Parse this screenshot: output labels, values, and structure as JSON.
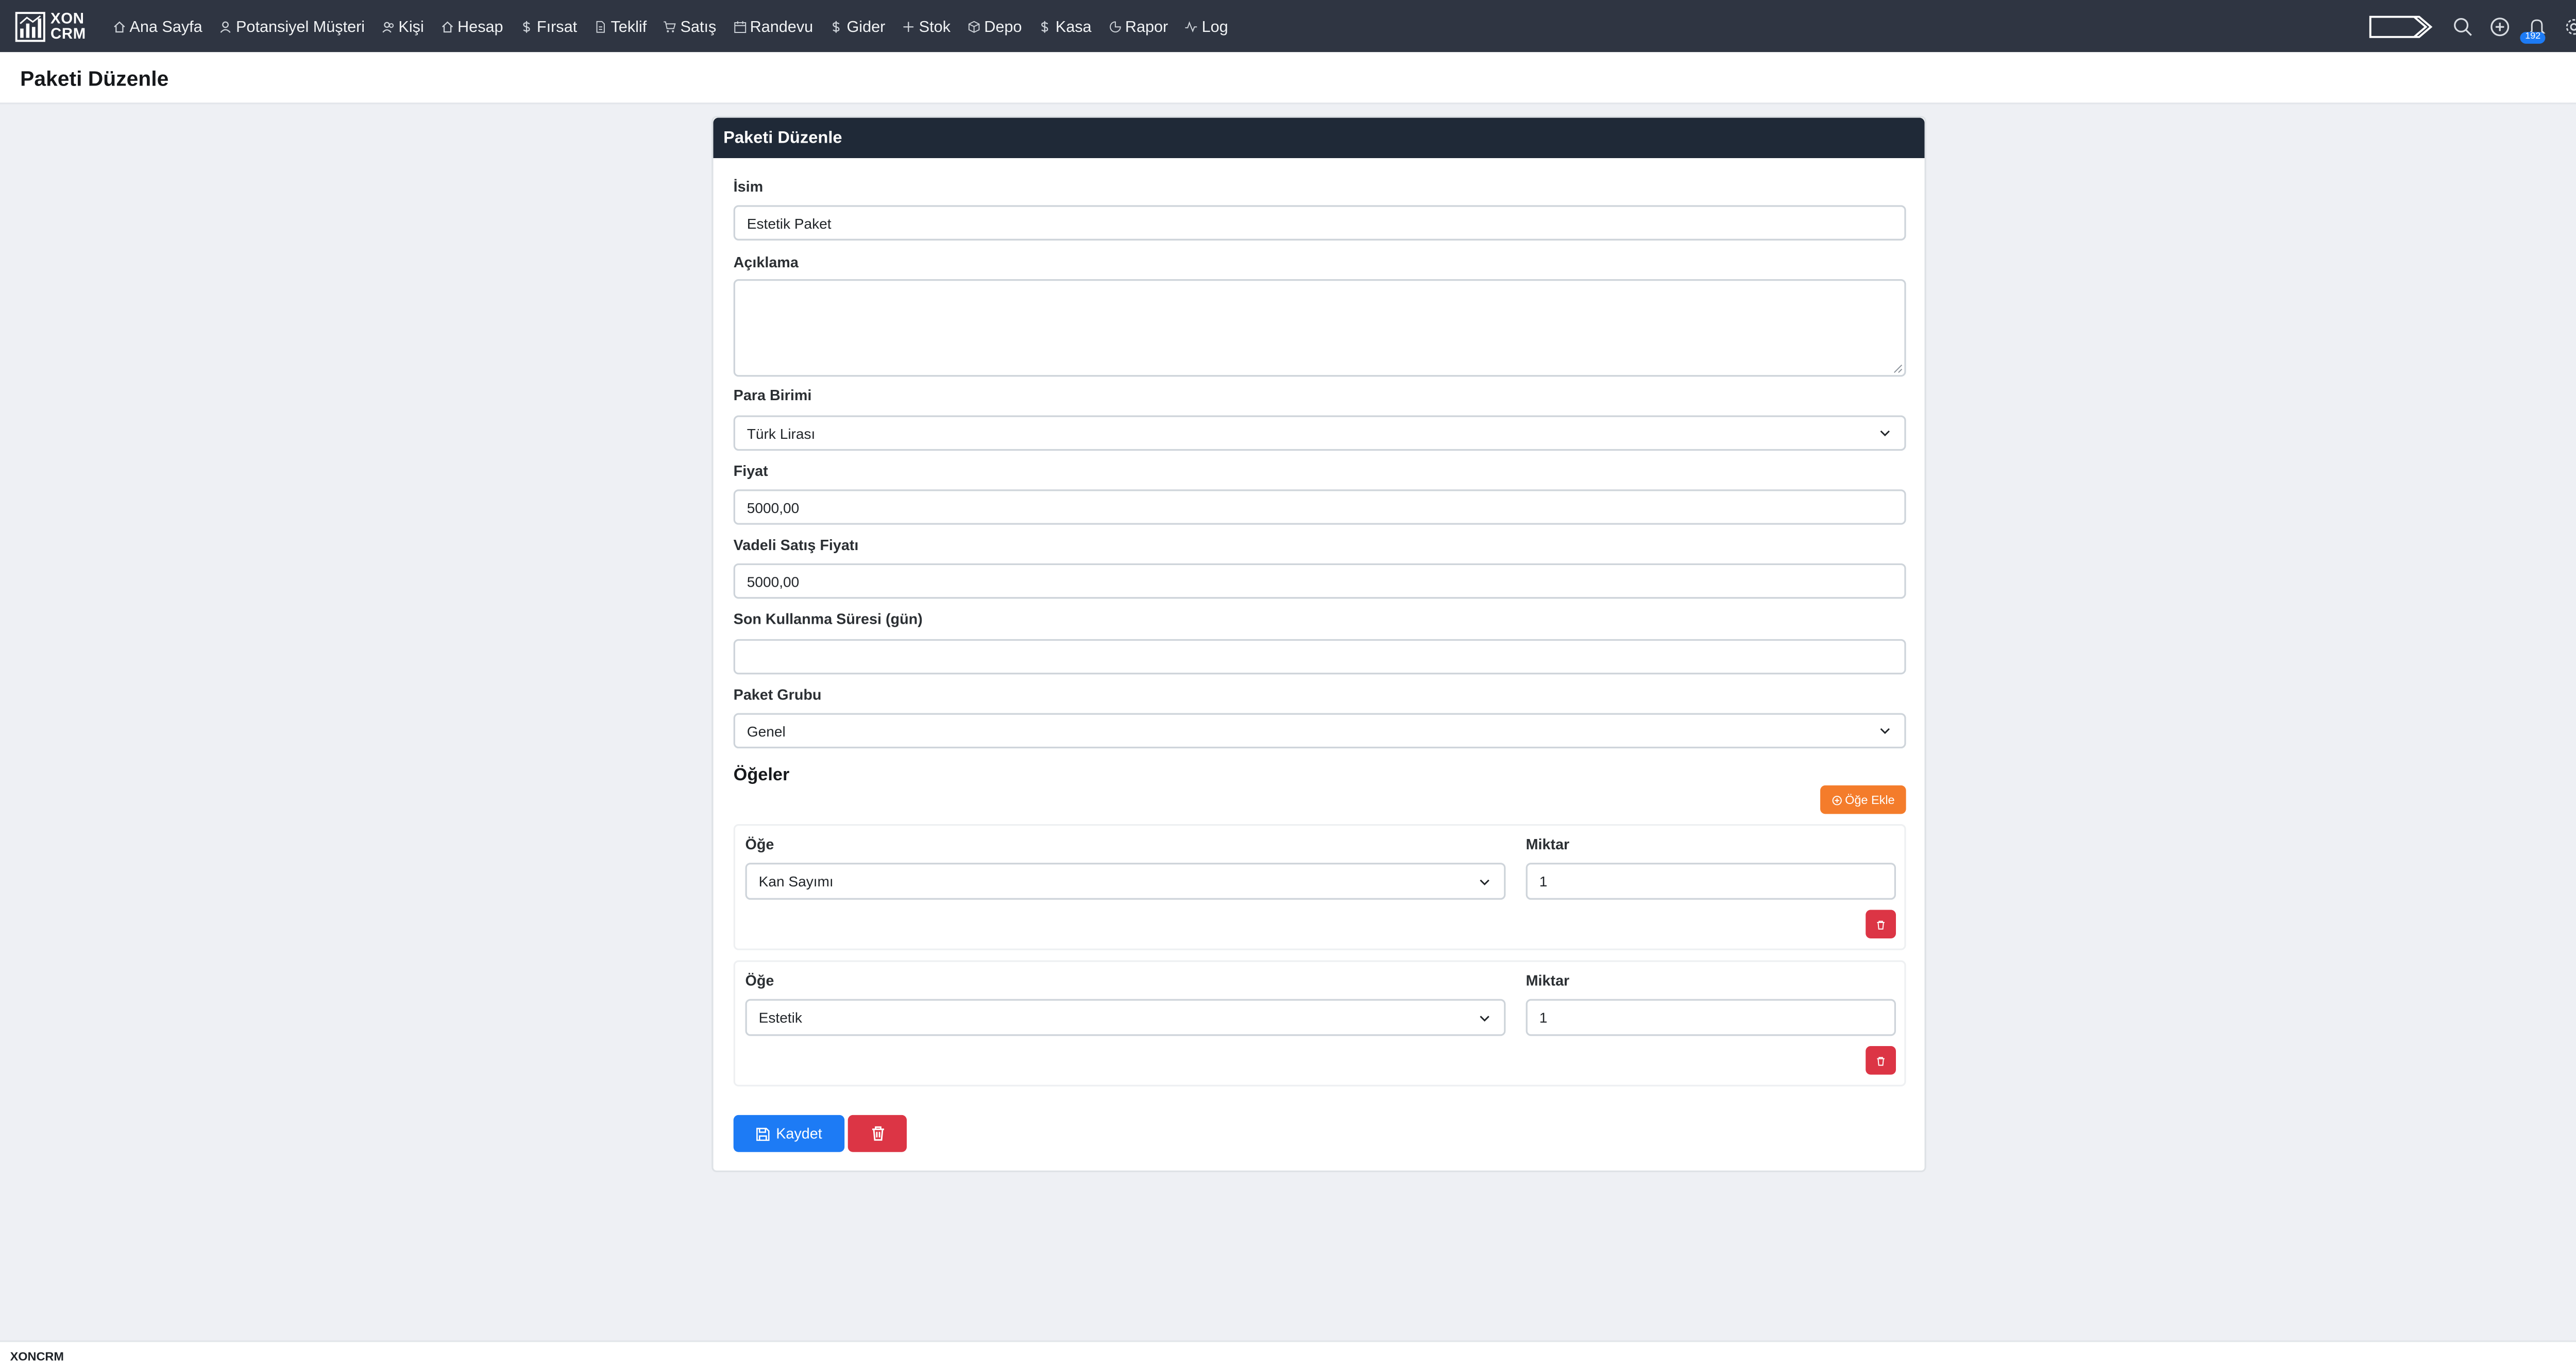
{
  "brand": {
    "name": "XON CRM",
    "line1": "XON",
    "line2": "CRM"
  },
  "nav": {
    "items": [
      {
        "label": "Ana Sayfa",
        "icon": "home-icon"
      },
      {
        "label": "Potansiyel Müşteri",
        "icon": "user-icon"
      },
      {
        "label": "Kişi",
        "icon": "users-icon"
      },
      {
        "label": "Hesap",
        "icon": "home-icon"
      },
      {
        "label": "Fırsat",
        "icon": "dollar-icon"
      },
      {
        "label": "Teklif",
        "icon": "document-icon"
      },
      {
        "label": "Satış",
        "icon": "cart-icon"
      },
      {
        "label": "Randevu",
        "icon": "calendar-icon"
      },
      {
        "label": "Gider",
        "icon": "dollar-icon"
      },
      {
        "label": "Stok",
        "icon": "plus-icon"
      },
      {
        "label": "Depo",
        "icon": "box-icon"
      },
      {
        "label": "Kasa",
        "icon": "dollar-icon"
      },
      {
        "label": "Rapor",
        "icon": "pie-chart-icon"
      },
      {
        "label": "Log",
        "icon": "activity-icon"
      }
    ],
    "right_icons": [
      "arrow-tag-icon",
      "search-icon",
      "plus-circle-icon",
      "bell-icon",
      "gear-icon",
      "user-icon"
    ],
    "notification_count": "192"
  },
  "page": {
    "title": "Paketi Düzenle"
  },
  "form": {
    "card_title": "Paketi Düzenle",
    "name_label": "İsim",
    "name_value": "Estetik Paket",
    "description_label": "Açıklama",
    "description_value": "",
    "currency_label": "Para Birimi",
    "currency_value": "Türk Lirası",
    "price_label": "Fiyat",
    "price_value": "5000,00",
    "term_price_label": "Vadeli Satış Fiyatı",
    "term_price_value": "5000,00",
    "expiry_label": "Son Kullanma Süresi (gün)",
    "expiry_value": "",
    "group_label": "Paket Grubu",
    "group_value": "Genel",
    "items_title": "Öğeler",
    "add_item_label": "Öğe Ekle",
    "items": [
      {
        "item_label": "Öğe",
        "item_value": "Kan Sayımı",
        "qty_label": "Miktar",
        "qty_value": "1"
      },
      {
        "item_label": "Öğe",
        "item_value": "Estetik",
        "qty_label": "Miktar",
        "qty_value": "1"
      }
    ],
    "save_label": "Kaydet"
  },
  "footer": {
    "text": "XONCRM"
  },
  "colors": {
    "navbar": "#2f3542",
    "card_header": "#1f2937",
    "primary": "#1d7bf5",
    "danger": "#dc3545",
    "warning": "#f47c2b",
    "background": "#eef0f4"
  }
}
